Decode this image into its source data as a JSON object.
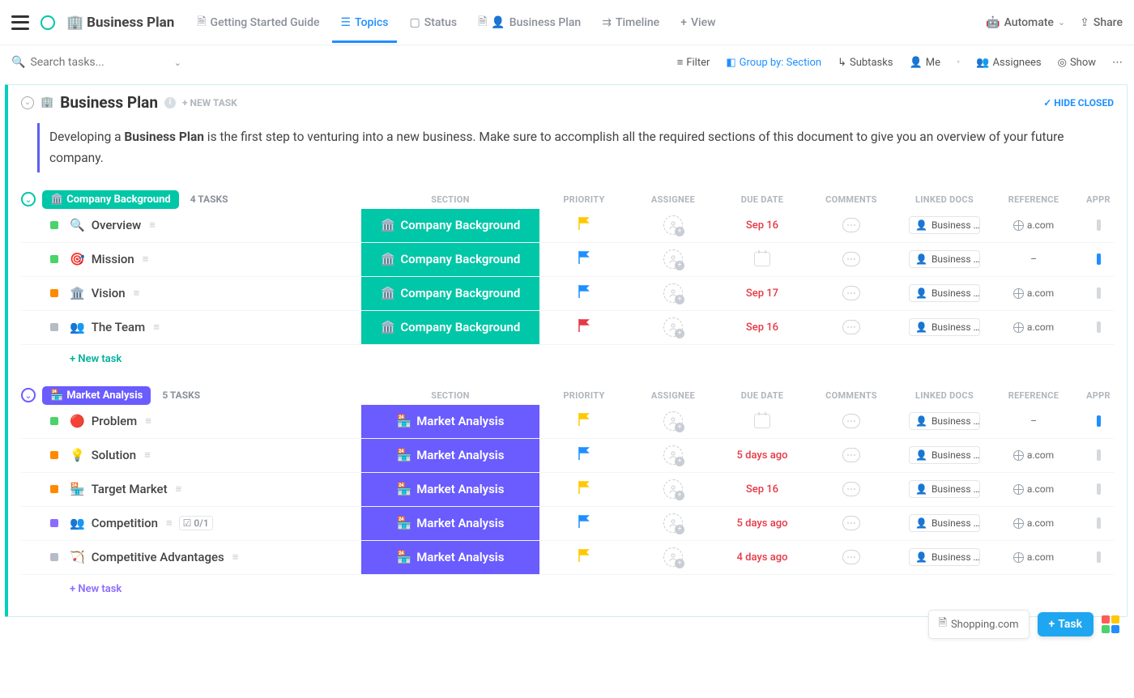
{
  "topbar": {
    "title": "Business Plan",
    "tabs": [
      {
        "label": "Getting Started Guide"
      },
      {
        "label": "Topics"
      },
      {
        "label": "Status"
      },
      {
        "label": "Business Plan"
      },
      {
        "label": "Timeline"
      },
      {
        "label": "View"
      }
    ],
    "automate": "Automate",
    "share": "Share"
  },
  "filter": {
    "search_placeholder": "Search tasks...",
    "filter": "Filter",
    "group": "Group by: Section",
    "subtasks": "Subtasks",
    "me": "Me",
    "assignees": "Assignees",
    "show": "Show"
  },
  "header": {
    "title": "Business Plan",
    "new_task": "+ NEW TASK",
    "hide_closed": "HIDE CLOSED",
    "desc_pre": "Developing a ",
    "desc_bold": "Business Plan",
    "desc_post": " is the first step to venturing into a new business. Make sure to accomplish all the required sections of this document to give you an overview of your future company."
  },
  "columns": {
    "section": "SECTION",
    "priority": "PRIORITY",
    "assignee": "ASSIGNEE",
    "due": "DUE DATE",
    "comments": "COMMENTS",
    "linked": "LINKED DOCS",
    "reference": "REFERENCE",
    "appr": "APPR"
  },
  "groups": [
    {
      "name": "Company Background",
      "count": "4 TASKS",
      "color": "#00c7a7",
      "section_label": "Company Background",
      "section_emoji": "🏛️",
      "rows": [
        {
          "sq": "green",
          "emoji": "🔍",
          "name": "Overview",
          "flag": "#ffc800",
          "due": "Sep 16",
          "doc": "Business …",
          "ref": "a.com",
          "bar": "gray"
        },
        {
          "sq": "green",
          "emoji": "🎯",
          "name": "Mission",
          "flag": "#1f8fff",
          "due": "",
          "doc": "Business …",
          "ref": "–",
          "bar": "blue"
        },
        {
          "sq": "orange",
          "emoji": "🏛️",
          "name": "Vision",
          "flag": "#1f8fff",
          "due": "Sep 17",
          "doc": "Business …",
          "ref": "a.com",
          "bar": "gray"
        },
        {
          "sq": "gray",
          "emoji": "👥",
          "name": "The Team",
          "flag": "#e63946",
          "due": "Sep 16",
          "doc": "Business …",
          "ref": "a.com",
          "bar": "gray"
        }
      ],
      "newtask": "+ New task"
    },
    {
      "name": "Market Analysis",
      "count": "5 TASKS",
      "color": "#6a5cff",
      "section_label": "Market Analysis",
      "section_emoji": "🏪",
      "rows": [
        {
          "sq": "green",
          "emoji": "🔴",
          "name": "Problem",
          "flag": "#ffc800",
          "due": "",
          "doc": "Business …",
          "ref": "–",
          "bar": "blue"
        },
        {
          "sq": "orange",
          "emoji": "💡",
          "name": "Solution",
          "flag": "#1f8fff",
          "due": "5 days ago",
          "doc": "Business …",
          "ref": "a.com",
          "bar": "gray"
        },
        {
          "sq": "orange",
          "emoji": "🏪",
          "name": "Target Market",
          "flag": "#ffc800",
          "due": "Sep 16",
          "doc": "Business …",
          "ref": "a.com",
          "bar": "gray"
        },
        {
          "sq": "purple",
          "emoji": "👥",
          "name": "Competition",
          "flag": "#1f8fff",
          "due": "5 days ago",
          "doc": "Business …",
          "ref": "a.com",
          "bar": "gray",
          "subtask": "0/1"
        },
        {
          "sq": "gray",
          "emoji": "🏹",
          "name": "Competitive Advantages",
          "flag": "#ffc800",
          "due": "4 days ago",
          "doc": "Business …",
          "ref": "a.com",
          "bar": "gray"
        }
      ],
      "newtask": "+ New task"
    }
  ],
  "bottom": {
    "shopping": "Shopping.com",
    "task": "Task"
  }
}
